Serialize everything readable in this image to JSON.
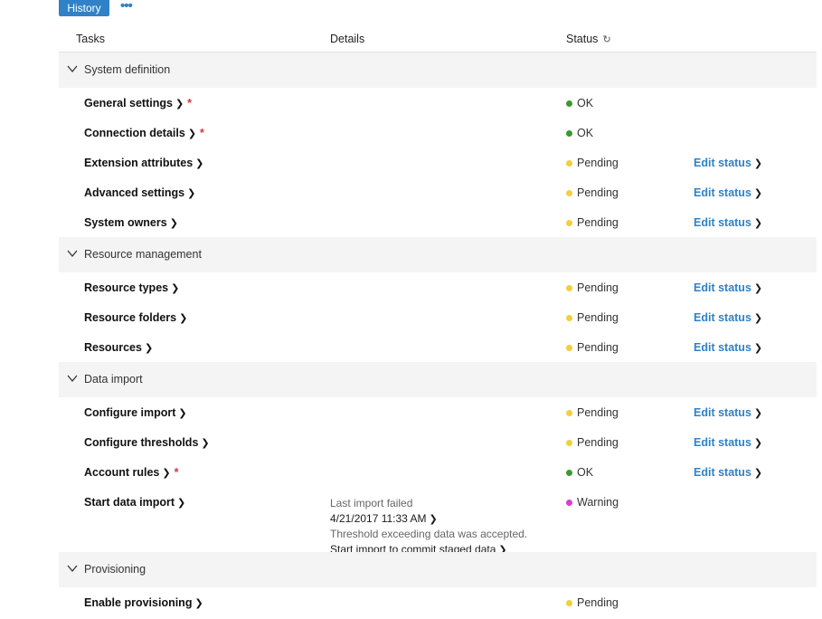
{
  "toolbar": {
    "history_label": "History",
    "more_icon": "more-dots-icon"
  },
  "columns": {
    "tasks": "Tasks",
    "details": "Details",
    "status": "Status"
  },
  "colors": {
    "accent": "#2f82c7",
    "ok": "#3a9a2e",
    "pending": "#f2cf3c",
    "warning": "#e03ad6",
    "required": "#e0303a"
  },
  "sections": [
    {
      "label": "System definition",
      "rows": [
        {
          "task": "General settings",
          "required": true,
          "status": "OK",
          "state": "ok",
          "edit": ""
        },
        {
          "task": "Connection details",
          "required": true,
          "status": "OK",
          "state": "ok",
          "edit": ""
        },
        {
          "task": "Extension attributes",
          "required": false,
          "status": "Pending",
          "state": "pending",
          "edit": "Edit status"
        },
        {
          "task": "Advanced settings",
          "required": false,
          "status": "Pending",
          "state": "pending",
          "edit": "Edit status"
        },
        {
          "task": "System owners",
          "required": false,
          "status": "Pending",
          "state": "pending",
          "edit": "Edit status"
        }
      ]
    },
    {
      "label": "Resource management",
      "rows": [
        {
          "task": "Resource types",
          "required": false,
          "status": "Pending",
          "state": "pending",
          "edit": "Edit status"
        },
        {
          "task": "Resource folders",
          "required": false,
          "status": "Pending",
          "state": "pending",
          "edit": "Edit status"
        },
        {
          "task": "Resources",
          "required": false,
          "status": "Pending",
          "state": "pending",
          "edit": "Edit status"
        }
      ]
    },
    {
      "label": "Data import",
      "rows": [
        {
          "task": "Configure import",
          "required": false,
          "status": "Pending",
          "state": "pending",
          "edit": "Edit status"
        },
        {
          "task": "Configure thresholds",
          "required": false,
          "status": "Pending",
          "state": "pending",
          "edit": "Edit status"
        },
        {
          "task": "Account rules",
          "required": true,
          "status": "OK",
          "state": "ok",
          "edit": "Edit status"
        },
        {
          "task": "Start data import",
          "required": false,
          "status": "Warning",
          "state": "warning",
          "edit": "",
          "details": {
            "line1": "Last import failed",
            "line2": "4/21/2017 11:33 AM",
            "line3": "Threshold exceeding data was accepted.",
            "line4": "Start import to commit staged data"
          }
        }
      ]
    },
    {
      "label": "Provisioning",
      "rows": [
        {
          "task": "Enable provisioning",
          "required": false,
          "status": "Pending",
          "state": "pending",
          "edit": ""
        }
      ]
    }
  ]
}
